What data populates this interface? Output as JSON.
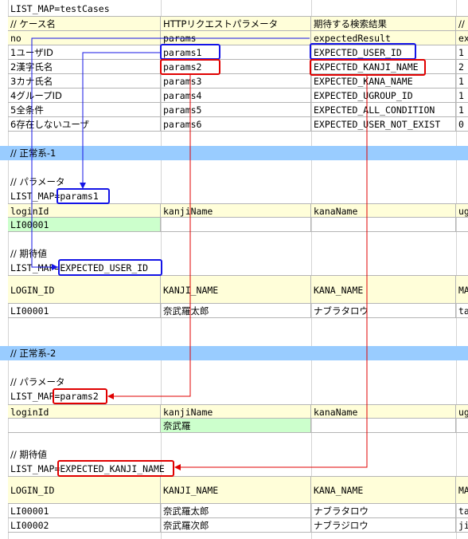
{
  "sheet": {
    "title": "LIST_MAP=testCases",
    "header": [
      "// ケース名",
      "HTTPリクエストパラメータ",
      "期待する検索結果",
      "//"
    ],
    "keys": [
      "no",
      "params",
      "expectedResult",
      "ex"
    ],
    "cases": [
      [
        "1ユーザID",
        "params1",
        "EXPECTED_USER_ID",
        "1"
      ],
      [
        "2漢字氏名",
        "params2",
        "EXPECTED_KANJI_NAME",
        "2"
      ],
      [
        "3カナ氏名",
        "params3",
        "EXPECTED_KANA_NAME",
        "1"
      ],
      [
        "4グループID",
        "params4",
        "EXPECTED_UGROUP_ID",
        "1"
      ],
      [
        "5全条件",
        "params5",
        "EXPECTED_ALL_CONDITION",
        "1"
      ],
      [
        "6存在しないユーザ",
        "params6",
        "EXPECTED_USER_NOT_EXIST",
        "0"
      ]
    ]
  },
  "section1": {
    "banner": "// 正常系-1",
    "param_comment": "// パラメータ",
    "param_map_prefix": "LIST_MAP=",
    "param_map_name": "params1",
    "param_header": [
      "loginId",
      "kanjiName",
      "kanaName",
      "ug"
    ],
    "param_values": [
      "LI00001",
      "",
      "",
      ""
    ],
    "expected_comment": "// 期待値",
    "expected_map_prefix": "LIST_MAP=",
    "expected_map_name": "EXPECTED_USER_ID",
    "expected_header": [
      "LOGIN_ID",
      "KANJI_NAME",
      "KANA_NAME",
      "MA"
    ],
    "expected_rows": [
      [
        "LI00001",
        "奈武羅太郎",
        "ナブラタロウ",
        "ta"
      ]
    ]
  },
  "section2": {
    "banner": "// 正常系-2",
    "param_comment": "// パラメータ",
    "param_map_prefix": "LIST_MAP=",
    "param_map_name": "params2",
    "param_header": [
      "loginId",
      "kanjiName",
      "kanaName",
      "ug"
    ],
    "param_values": [
      "",
      "奈武羅",
      "",
      ""
    ],
    "expected_comment": "// 期待値",
    "expected_map_prefix": "LIST_MAP=",
    "expected_map_name": "EXPECTED_KANJI_NAME",
    "expected_header": [
      "LOGIN_ID",
      "KANJI_NAME",
      "KANA_NAME",
      "MA"
    ],
    "expected_rows": [
      [
        "LI00001",
        "奈武羅太郎",
        "ナブラタロウ",
        "ta"
      ],
      [
        "LI00002",
        "奈武羅次郎",
        "ナブラジロウ",
        "ji"
      ]
    ]
  },
  "colors": {
    "grid": "#b5b5b5",
    "header_fill": "#fffed9",
    "value_fill": "#ccffcc",
    "banner_fill": "#99ccff",
    "blue_highlight": "#1414e6",
    "red_highlight": "#e00000"
  }
}
